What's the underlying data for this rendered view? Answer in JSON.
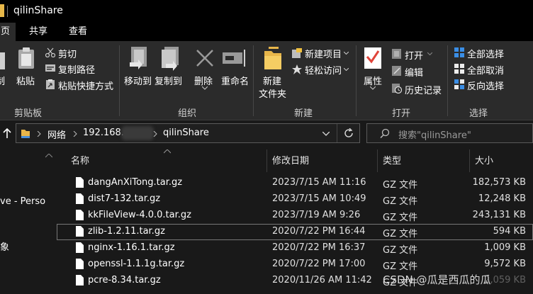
{
  "window": {
    "title": "qilinShare"
  },
  "tabs": [
    {
      "label": "页",
      "active": true
    },
    {
      "label": "共享",
      "active": false
    },
    {
      "label": "查看",
      "active": false
    }
  ],
  "ribbon": {
    "clipboard": {
      "partial_label": "制",
      "paste": "粘贴",
      "cut": "剪切",
      "copy_path": "复制路径",
      "paste_shortcut": "粘贴快捷方式",
      "group": "剪贴板"
    },
    "organize": {
      "move_to": "移动到",
      "copy_to": "复制到",
      "delete": "删除",
      "rename": "重命名",
      "group": "组织"
    },
    "new": {
      "new_item": "新建项目",
      "easy_access": "轻松访问",
      "new_folder_line1": "新建",
      "new_folder_line2": "文件夹",
      "group": "新建"
    },
    "open": {
      "properties": "属性",
      "open": "打开",
      "edit": "编辑",
      "history": "历史记录",
      "group": "打开"
    },
    "select": {
      "select_all": "全部选择",
      "select_none": "全部取消",
      "invert": "反向选择",
      "group": "选择"
    }
  },
  "address": {
    "crumbs": [
      "网络",
      "192.168.",
      "qilinShare"
    ],
    "search_placeholder": "搜索\"qilinShare\""
  },
  "navpane": {
    "item1": "ve - Perso",
    "item2": "象"
  },
  "columns": {
    "name": "名称",
    "date": "修改日期",
    "type": "类型",
    "size": "大小"
  },
  "files": [
    {
      "name": "dangAnXiTong.tar.gz",
      "date": "2023/7/15 AM 11:16",
      "type": "GZ 文件",
      "size": "182,573 KB"
    },
    {
      "name": "dist7-132.tar.gz",
      "date": "2023/7/15 AM 10:49",
      "type": "GZ 文件",
      "size": "12,248 KB"
    },
    {
      "name": "kkFileView-4.0.0.tar.gz",
      "date": "2023/7/19 AM 9:26",
      "type": "GZ 文件",
      "size": "243,131 KB"
    },
    {
      "name": "zlib-1.2.11.tar.gz",
      "date": "2020/7/22 PM 16:44",
      "type": "GZ 文件",
      "size": "594 KB"
    },
    {
      "name": "nginx-1.16.1.tar.gz",
      "date": "2020/7/22 PM 16:37",
      "type": "GZ 文件",
      "size": "1,009 KB"
    },
    {
      "name": "openssl-1.1.1g.tar.gz",
      "date": "2020/7/22 PM 17:00",
      "type": "GZ 文件",
      "size": "9,572 KB"
    },
    {
      "name": "pcre-8.34.tar.gz",
      "date": "2020/11/26 AM 11:42",
      "type": "GZ 文件",
      "size": "2,059 KB"
    }
  ],
  "watermark": "CSDN @瓜是西瓜的瓜"
}
